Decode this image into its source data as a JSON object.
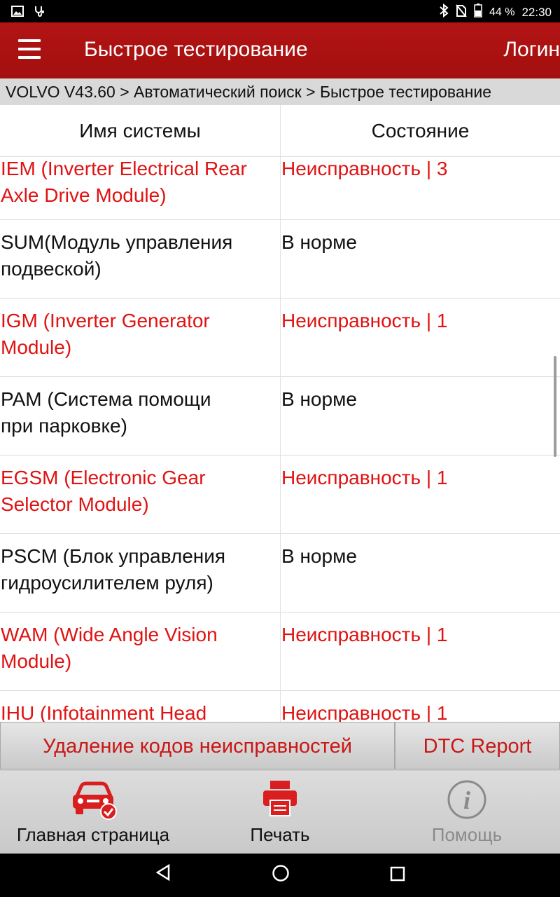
{
  "status_bar": {
    "battery_percent": "44 %",
    "time": "22:30",
    "left_icons": [
      "image-icon",
      "usb-stethoscope-icon"
    ],
    "right_icons": [
      "bluetooth-icon",
      "no-sim-icon",
      "battery-icon"
    ]
  },
  "app_bar": {
    "title": "Быстрое тестирование",
    "login_label": "Логин"
  },
  "breadcrumb": "VOLVO V43.60 > Автоматический поиск > Быстрое тестирование",
  "table": {
    "headers": {
      "system_name": "Имя системы",
      "status": "Состояние"
    },
    "rows": [
      {
        "name_line1": "IEM (Inverter Electrical Rear",
        "name_line2": "Axle Drive Module)",
        "status": "Неисправность  | 3",
        "fault": true
      },
      {
        "name_line1": "SUM(Модуль управления",
        "name_line2": "подвеской)",
        "status": "В норме",
        "fault": false
      },
      {
        "name_line1": "IGM (Inverter Generator",
        "name_line2": "Module)",
        "status": "Неисправность  | 1",
        "fault": true
      },
      {
        "name_line1": "PAM (Система помощи",
        "name_line2": "при парковке)",
        "status": "В норме",
        "fault": false
      },
      {
        "name_line1": "EGSM (Electronic Gear",
        "name_line2": "Selector Module)",
        "status": "Неисправность  | 1",
        "fault": true
      },
      {
        "name_line1": "PSCM (Блок управления",
        "name_line2": "гидроусилителем руля)",
        "status": "В норме",
        "fault": false
      },
      {
        "name_line1": "WAM (Wide Angle Vision",
        "name_line2": "Module)",
        "status": "Неисправность  | 1",
        "fault": true
      },
      {
        "name_line1": "IHU (Infotainment Head",
        "name_line2": "",
        "status": "Неисправность  | 1",
        "fault": true
      }
    ]
  },
  "actions": {
    "clear_codes": "Удаление кодов неисправностей",
    "dtc_report": "DTC Report"
  },
  "bottom_nav": {
    "home": "Главная страница",
    "print": "Печать",
    "help": "Помощь"
  },
  "colors": {
    "accent_red": "#b21414",
    "fault_text": "#e01212",
    "normal_text": "#111111"
  }
}
